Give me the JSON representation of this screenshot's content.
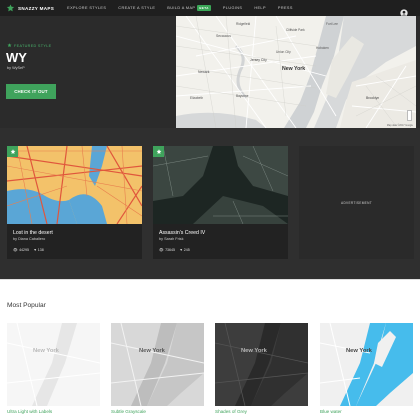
{
  "nav": {
    "brand": "SNAZZY MAPS",
    "links": [
      "EXPLORE STYLES",
      "CREATE A STYLE",
      "BUILD A MAP",
      "PLUGINS",
      "HELP",
      "PRESS"
    ],
    "beta_badge": "BETA",
    "icons": [
      "snazzy-logo-icon",
      "user-account-icon"
    ]
  },
  "hero": {
    "label": "FEATURED STYLE",
    "title": "WY",
    "author": "by WySeP",
    "button": "CHECK IT OUT",
    "map_labels": [
      "Secaucus",
      "Ridgefield",
      "Cliffside Park",
      "Union City",
      "Jersey City",
      "New York",
      "Newark",
      "Bayonne",
      "Brooklyn",
      "Elizabeth",
      "Fort Lee",
      "Hoboken"
    ],
    "map_footer": "Map data ©2017 Google"
  },
  "cards": [
    {
      "title": "Lost in the desert",
      "author": "by Diana Caballero",
      "views": "44295",
      "likes": "138"
    },
    {
      "title": "Assassin's Creed IV",
      "author": "by Sarah Frisk",
      "views": "73645",
      "likes": "245"
    }
  ],
  "ad": {
    "label": "ADVERTISEMENT"
  },
  "popular": {
    "title": "Most Popular",
    "items": [
      {
        "label": "Ultra Light with Labels",
        "city": "New York"
      },
      {
        "label": "Subtle Grayscale",
        "city": "New York"
      },
      {
        "label": "Shades of Grey",
        "city": "New York"
      },
      {
        "label": "Blue water",
        "city": "New York"
      }
    ]
  },
  "colors": {
    "accent": "#3fa35c",
    "nav_bg": "#1f1f1f",
    "page_bg": "#2e2e2e"
  }
}
